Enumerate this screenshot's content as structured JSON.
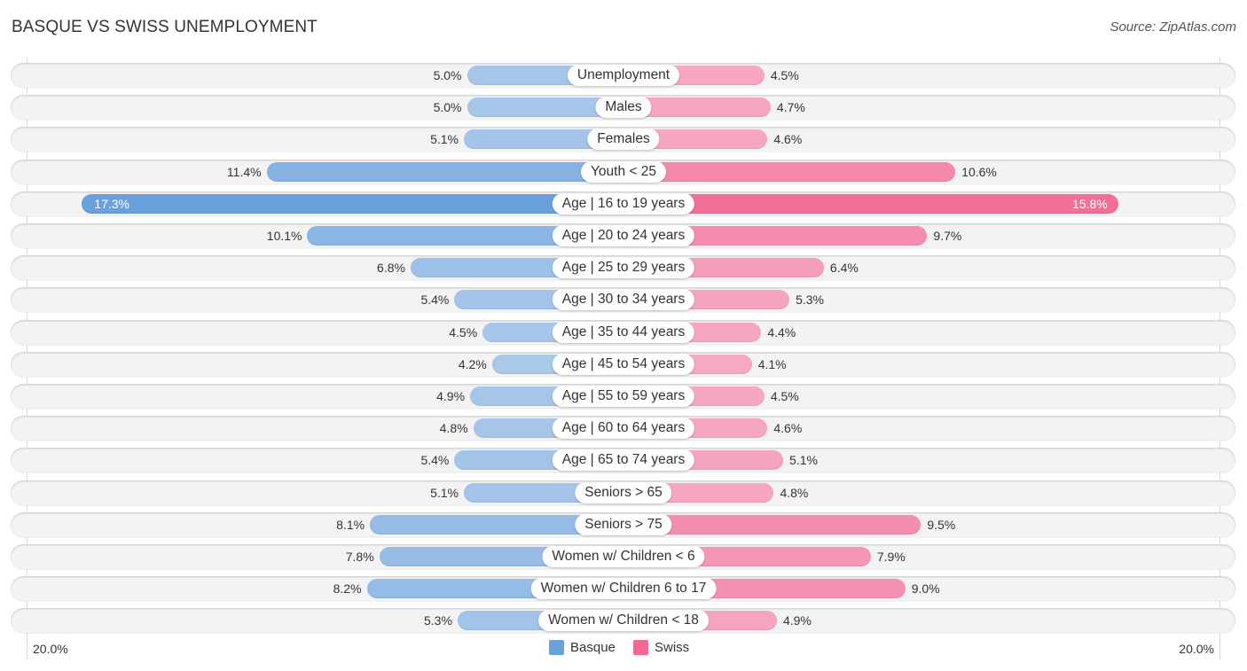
{
  "header": {
    "title": "BASQUE VS SWISS UNEMPLOYMENT",
    "source": "Source: ZipAtlas.com"
  },
  "colors": {
    "basque_light": "#a9c8ea",
    "basque_dark": "#6aa1dc",
    "swiss_light": "#f6a9c2",
    "swiss_dark": "#f26892",
    "track": "#f3f3f3"
  },
  "chart_data": {
    "type": "bar",
    "orientation": "horizontal-diverging",
    "title": "BASQUE VS SWISS UNEMPLOYMENT",
    "xlabel": "",
    "ylabel": "",
    "xlim": [
      -20.0,
      20.0
    ],
    "axis_min_label": "20.0%",
    "axis_max_label": "20.0%",
    "legend_position": "bottom-center",
    "grid": false,
    "categories": [
      "Unemployment",
      "Males",
      "Females",
      "Youth < 25",
      "Age | 16 to 19 years",
      "Age | 20 to 24 years",
      "Age | 25 to 29 years",
      "Age | 30 to 34 years",
      "Age | 35 to 44 years",
      "Age | 45 to 54 years",
      "Age | 55 to 59 years",
      "Age | 60 to 64 years",
      "Age | 65 to 74 years",
      "Seniors > 65",
      "Seniors > 75",
      "Women w/ Children < 6",
      "Women w/ Children 6 to 17",
      "Women w/ Children < 18"
    ],
    "series": [
      {
        "name": "Basque",
        "side": "left",
        "values": [
          5.0,
          5.0,
          5.1,
          11.4,
          17.3,
          10.1,
          6.8,
          5.4,
          4.5,
          4.2,
          4.9,
          4.8,
          5.4,
          5.1,
          8.1,
          7.8,
          8.2,
          5.3
        ],
        "labels": [
          "5.0%",
          "5.0%",
          "5.1%",
          "11.4%",
          "17.3%",
          "10.1%",
          "6.8%",
          "5.4%",
          "4.5%",
          "4.2%",
          "4.9%",
          "4.8%",
          "5.4%",
          "5.1%",
          "8.1%",
          "7.8%",
          "8.2%",
          "5.3%"
        ]
      },
      {
        "name": "Swiss",
        "side": "right",
        "values": [
          4.5,
          4.7,
          4.6,
          10.6,
          15.8,
          9.7,
          6.4,
          5.3,
          4.4,
          4.1,
          4.5,
          4.6,
          5.1,
          4.8,
          9.5,
          7.9,
          9.0,
          4.9
        ],
        "labels": [
          "4.5%",
          "4.7%",
          "4.6%",
          "10.6%",
          "15.8%",
          "9.7%",
          "6.4%",
          "5.3%",
          "4.4%",
          "4.1%",
          "4.5%",
          "4.6%",
          "5.1%",
          "4.8%",
          "9.5%",
          "7.9%",
          "9.0%",
          "4.9%"
        ]
      }
    ]
  },
  "legend": {
    "items": [
      {
        "label": "Basque",
        "color": "#6aa1dc"
      },
      {
        "label": "Swiss",
        "color": "#f26892"
      }
    ]
  }
}
